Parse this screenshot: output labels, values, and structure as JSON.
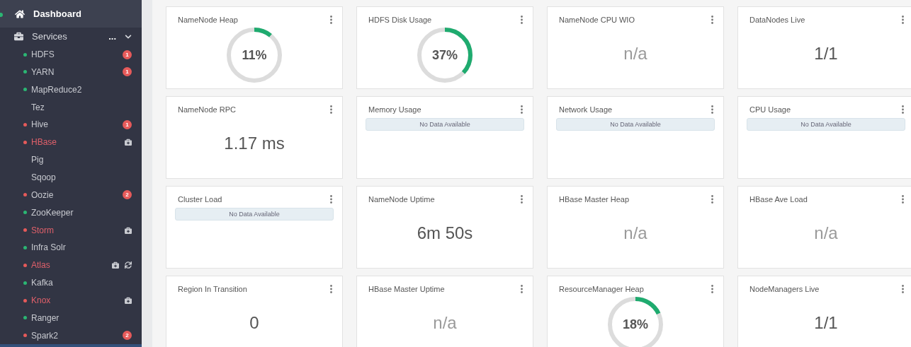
{
  "sidebar": {
    "dashboard": {
      "label": "Dashboard",
      "selected": true
    },
    "services": {
      "label": "Services",
      "more": "...",
      "expanded": true
    },
    "items": [
      {
        "name": "HDFS",
        "color": "#2bb673",
        "alerts": "1",
        "maintenance": false,
        "refresh": false
      },
      {
        "name": "YARN",
        "color": "#2bb673",
        "alerts": "1",
        "maintenance": false,
        "refresh": false
      },
      {
        "name": "MapReduce2",
        "color": "#2bb673",
        "maintenance": false,
        "refresh": false
      },
      {
        "name": "Tez",
        "maintenance": false,
        "refresh": false
      },
      {
        "name": "Hive",
        "color": "#e65a5a",
        "alerts": "1",
        "maintenance": false,
        "refresh": false
      },
      {
        "name": "HBase",
        "color": "#e65a5a",
        "maintenance": true,
        "refresh": false
      },
      {
        "name": "Pig",
        "maintenance": false,
        "refresh": false
      },
      {
        "name": "Sqoop",
        "maintenance": false,
        "refresh": false
      },
      {
        "name": "Oozie",
        "color": "#e65a5a",
        "alerts": "2",
        "maintenance": false,
        "refresh": false
      },
      {
        "name": "ZooKeeper",
        "color": "#2bb673",
        "maintenance": false,
        "refresh": false
      },
      {
        "name": "Storm",
        "color": "#e65a5a",
        "maintenance": true,
        "refresh": false
      },
      {
        "name": "Infra Solr",
        "color": "#2bb673",
        "maintenance": false,
        "refresh": false
      },
      {
        "name": "Atlas",
        "color": "#e65a5a",
        "maintenance": true,
        "refresh": true
      },
      {
        "name": "Kafka",
        "color": "#2bb673",
        "maintenance": false,
        "refresh": false
      },
      {
        "name": "Knox",
        "color": "#e65a5a",
        "maintenance": true,
        "refresh": false
      },
      {
        "name": "Ranger",
        "color": "#2bb673",
        "maintenance": false,
        "refresh": false
      },
      {
        "name": "Spark2",
        "color": "#e65a5a",
        "alerts": "2",
        "maintenance": false,
        "refresh": false
      }
    ]
  },
  "widgets": [
    {
      "title": "NameNode Heap",
      "kind": "gauge",
      "value": "11%"
    },
    {
      "title": "HDFS Disk Usage",
      "kind": "gauge",
      "value": "37%"
    },
    {
      "title": "NameNode CPU WIO",
      "kind": "number",
      "value": "n/a",
      "empty": true
    },
    {
      "title": "DataNodes Live",
      "kind": "number",
      "value": "1/1",
      "empty": false
    },
    {
      "title": "NameNode RPC",
      "kind": "number",
      "value": "1.17 ms",
      "empty": false
    },
    {
      "title": "Memory Usage",
      "kind": "nodata",
      "message": "No Data Available"
    },
    {
      "title": "Network Usage",
      "kind": "nodata",
      "message": "No Data Available"
    },
    {
      "title": "CPU Usage",
      "kind": "nodata",
      "message": "No Data Available"
    },
    {
      "title": "Cluster Load",
      "kind": "nodata",
      "message": "No Data Available"
    },
    {
      "title": "NameNode Uptime",
      "kind": "number",
      "value": "6m 50s",
      "empty": false
    },
    {
      "title": "HBase Master Heap",
      "kind": "number",
      "value": "n/a",
      "empty": true
    },
    {
      "title": "HBase Ave Load",
      "kind": "number",
      "value": "n/a",
      "empty": true
    },
    {
      "title": "Region In Transition",
      "kind": "number",
      "value": "0",
      "empty": false
    },
    {
      "title": "HBase Master Uptime",
      "kind": "number",
      "value": "n/a",
      "empty": true
    },
    {
      "title": "ResourceManager Heap",
      "kind": "gauge",
      "value": "18%"
    },
    {
      "title": "NodeManagers Live",
      "kind": "number",
      "value": "1/1",
      "empty": false
    }
  ]
}
